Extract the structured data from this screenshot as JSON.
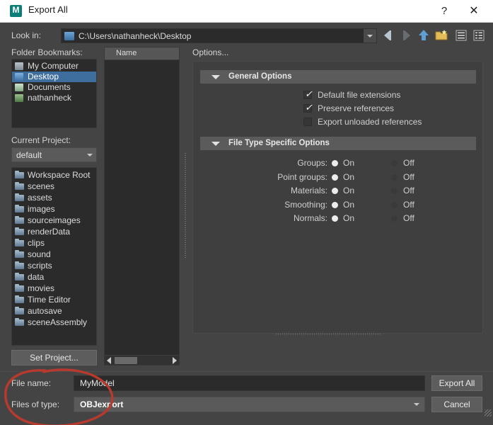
{
  "window": {
    "title": "Export All",
    "logo_letter": "M",
    "logo_color": "#0d7d77",
    "help_glyph": "?",
    "close_glyph": "✕"
  },
  "lookin": {
    "label": "Look in:",
    "path": "C:\\Users\\nathanheck\\Desktop",
    "folder_icon": "drive-icon",
    "dropdown_icon": "chevron-down-icon",
    "toolbar": [
      {
        "name": "back-icon",
        "glyph": "◀",
        "enabled": true,
        "color": "#b8c4cf"
      },
      {
        "name": "forward-icon",
        "glyph": "▶",
        "enabled": false,
        "color": "#6e6e6e"
      },
      {
        "name": "parent-dir-icon",
        "glyph": "⬆",
        "enabled": true,
        "color": "#7fb4e2"
      },
      {
        "name": "new-folder-icon",
        "glyph": "⬛",
        "enabled": true,
        "color": "#e0b84e"
      },
      {
        "name": "list-view-icon",
        "glyph": "☰",
        "enabled": true,
        "color": "#c8c8c8"
      },
      {
        "name": "detail-view-icon",
        "glyph": "☷",
        "enabled": true,
        "color": "#c8c8c8"
      }
    ]
  },
  "sidebar": {
    "bookmarks_label": "Folder Bookmarks:",
    "bookmarks": [
      {
        "label": "My Computer",
        "icon": "ico-computer",
        "selected": false
      },
      {
        "label": "Desktop",
        "icon": "ico-desktop",
        "selected": true
      },
      {
        "label": "Documents",
        "icon": "ico-docs",
        "selected": false
      },
      {
        "label": "nathanheck",
        "icon": "ico-user",
        "selected": false
      }
    ],
    "current_project_label": "Current Project:",
    "current_project_value": "default",
    "folders": [
      "Workspace Root",
      "scenes",
      "assets",
      "images",
      "sourceimages",
      "renderData",
      "clips",
      "sound",
      "scripts",
      "data",
      "movies",
      "Time Editor",
      "autosave",
      "sceneAssembly"
    ],
    "set_project_label": "Set Project..."
  },
  "filepanel": {
    "column_header": "Name",
    "rows": []
  },
  "options": {
    "label": "Options...",
    "sections": [
      {
        "title": "General Options",
        "expanded": true,
        "checkboxes": [
          {
            "label": "Default file extensions",
            "checked": true
          },
          {
            "label": "Preserve references",
            "checked": true
          },
          {
            "label": "Export unloaded references",
            "checked": false
          }
        ]
      },
      {
        "title": "File Type Specific Options",
        "expanded": true,
        "radios": [
          {
            "name": "Groups:",
            "on_label": "On",
            "off_label": "Off",
            "value": "On"
          },
          {
            "name": "Point groups:",
            "on_label": "On",
            "off_label": "Off",
            "value": "On"
          },
          {
            "name": "Materials:",
            "on_label": "On",
            "off_label": "Off",
            "value": "On"
          },
          {
            "name": "Smoothing:",
            "on_label": "On",
            "off_label": "Off",
            "value": "On"
          },
          {
            "name": "Normals:",
            "on_label": "On",
            "off_label": "Off",
            "value": "On"
          }
        ]
      }
    ]
  },
  "bottom": {
    "filename_label": "File name:",
    "filename_value": "MyModel",
    "filetype_label": "Files of type:",
    "filetype_value": "OBJexport",
    "export_button": "Export All",
    "cancel_button": "Cancel"
  },
  "annotation": {
    "shape": "ellipse",
    "color": "#c0392b",
    "description": "hand-drawn red circle around file name and file type fields"
  }
}
